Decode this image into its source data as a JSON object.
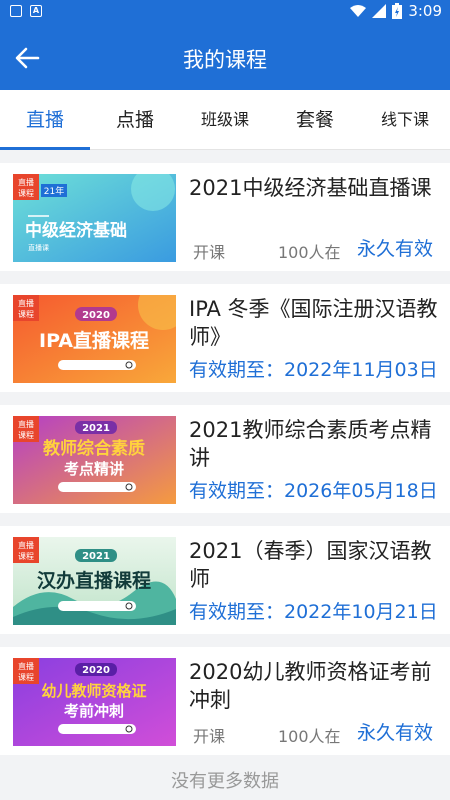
{
  "status_bar": {
    "time": "3:09",
    "left_icons": [
      "app-notification-icon",
      "font-notification-icon"
    ],
    "right_icons": [
      "wifi-icon",
      "signal-icon",
      "battery-charging-icon"
    ]
  },
  "header": {
    "title": "我的课程",
    "back_icon": "back-arrow-icon"
  },
  "tabs": [
    {
      "label": "直播",
      "active": true
    },
    {
      "label": "点播",
      "active": false
    },
    {
      "label": "班级课",
      "active": false
    },
    {
      "label": "套餐",
      "active": false
    },
    {
      "label": "线下课",
      "active": false
    }
  ],
  "courses": [
    {
      "title": "2021中级经济基础直播课",
      "thumb": {
        "tag1": "直播",
        "tag2": "课程",
        "year": "21年",
        "main": "中级经济基础",
        "sub": "直播课",
        "sub2": "",
        "theme": "teal"
      },
      "open_label": "开课",
      "count": "100人在",
      "permanent": "永久有效"
    },
    {
      "title": "IPA 冬季《国际注册汉语教师》",
      "thumb": {
        "tag1": "直播",
        "tag2": "课程",
        "year": "2020",
        "main": "IPA直播课程",
        "sub": "",
        "sub2": "",
        "theme": "orange"
      },
      "valid": "有效期至：2022年11月03日"
    },
    {
      "title": "2021教师综合素质考点精讲",
      "thumb": {
        "tag1": "直播",
        "tag2": "课程",
        "year": "2021",
        "main": "教师综合素质",
        "sub": "",
        "sub2": "考点精讲",
        "theme": "purple"
      },
      "valid": "有效期至：2026年05月18日"
    },
    {
      "title": "2021（春季）国家汉语教师",
      "thumb": {
        "tag1": "直播",
        "tag2": "课程",
        "year": "2021",
        "main": "汉办直播课程",
        "sub": "",
        "sub2": "",
        "theme": "green"
      },
      "valid": "有效期至：2022年10月21日"
    },
    {
      "title": "2020幼儿教师资格证考前冲刺",
      "thumb": {
        "tag1": "直播",
        "tag2": "课程",
        "year": "2020",
        "main": "幼儿教师资格证",
        "sub": "",
        "sub2": "考前冲刺",
        "theme": "violet"
      },
      "open_label": "开课",
      "count": "100人在",
      "permanent": "永久有效"
    }
  ],
  "footer": "没有更多数据",
  "colors": {
    "primary": "#1f6fd6",
    "background": "#f2f3f5"
  }
}
